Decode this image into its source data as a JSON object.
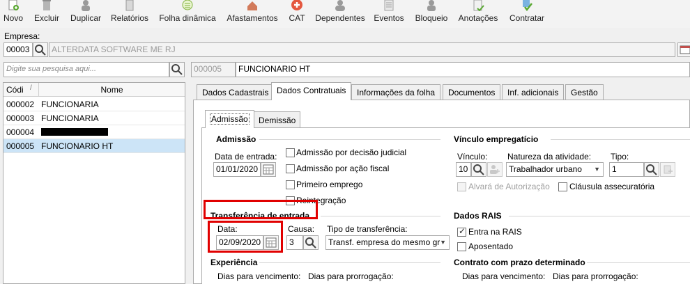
{
  "toolbar": {
    "items": [
      {
        "label": "Novo",
        "icon": "new-icon"
      },
      {
        "label": "Excluir",
        "icon": "trash-icon"
      },
      {
        "label": "Duplicar",
        "icon": "duplicate-icon"
      },
      {
        "label": "Relatórios",
        "icon": "report-icon"
      },
      {
        "label": "Folha dinâmica",
        "icon": "spreadsheet-icon"
      },
      {
        "label": "Afastamentos",
        "icon": "house-icon"
      },
      {
        "label": "CAT",
        "icon": "medical-cross-icon"
      },
      {
        "label": "Dependentes",
        "icon": "people-icon"
      },
      {
        "label": "Eventos",
        "icon": "events-icon"
      },
      {
        "label": "Bloqueio",
        "icon": "lock-user-icon"
      },
      {
        "label": "Anotações",
        "icon": "notes-icon"
      },
      {
        "label": "Contratar",
        "icon": "hire-icon"
      }
    ]
  },
  "empresa": {
    "label": "Empresa:",
    "code": "00003",
    "name": "ALTERDATA SOFTWARE ME RJ"
  },
  "search": {
    "placeholder": "Digite sua pesquisa aqui..."
  },
  "employee": {
    "code": "000005",
    "name": "FUNCIONARIO HT"
  },
  "list": {
    "col_code": "Códi",
    "col_name": "Nome",
    "rows": [
      {
        "code": "000002",
        "name": "FUNCIONARIA"
      },
      {
        "code": "000003",
        "name": "FUNCIONARIA"
      },
      {
        "code": "000004",
        "name": ""
      },
      {
        "code": "000005",
        "name": "FUNCIONARIO HT"
      }
    ]
  },
  "tabs": [
    "Dados Cadastrais",
    "Dados Contratuais",
    "Informações da folha",
    "Documentos",
    "Inf. adicionais",
    "Gestão"
  ],
  "subtabs": [
    "Admissão",
    "Demissão"
  ],
  "admissao": {
    "title": "Admissão",
    "date_label": "Data de entrada:",
    "date_value": "01/01/2020",
    "checks": [
      "Admissão por decisão judicial",
      "Admissão por ação fiscal",
      "Primeiro emprego",
      "Reintegração"
    ]
  },
  "vinculo": {
    "title": "Vínculo empregatício",
    "vinculo_label": "Vínculo:",
    "vinculo_value": "10",
    "natureza_label": "Natureza da atividade:",
    "natureza_value": "Trabalhador urbano",
    "tipo_label": "Tipo:",
    "tipo_value": "1",
    "alvara": "Alvará de Autorização",
    "clausula": "Cláusula assecuratória"
  },
  "transferencia": {
    "title": "Transferência de entrada",
    "data_label": "Data:",
    "data_value": "02/09/2020",
    "causa_label": "Causa:",
    "causa_value": "3",
    "tipo_label": "Tipo de transferência:",
    "tipo_value": "Transf. empresa do mesmo gr"
  },
  "rais": {
    "title": "Dados RAIS",
    "entra": "Entra na RAIS",
    "aposentado": "Aposentado"
  },
  "experiencia": {
    "title": "Experiência",
    "venc_label": "Dias para vencimento:",
    "prorr_label": "Dias para prorrogação:"
  },
  "contrato": {
    "title": "Contrato com prazo determinado",
    "venc_label": "Dias para vencimento:",
    "prorr_label": "Dias para prorrogação:"
  },
  "colors": {
    "highlight": "#e10000",
    "selection": "#cce4f7"
  }
}
